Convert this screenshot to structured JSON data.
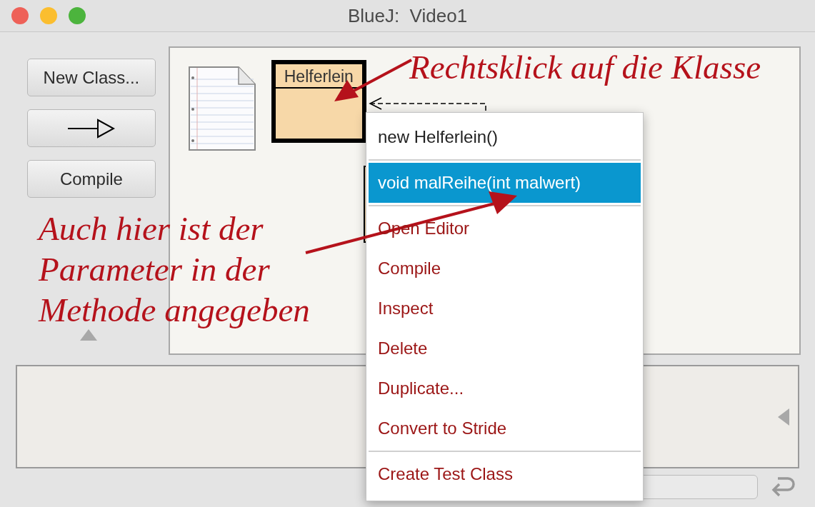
{
  "window": {
    "title": "BlueJ:  Video1"
  },
  "toolbar_buttons": [
    {
      "kind": "text",
      "label": "New Class..."
    },
    {
      "kind": "arrow"
    },
    {
      "kind": "text",
      "label": "Compile"
    }
  ],
  "diagram": {
    "classes": [
      {
        "name": "Helferlein"
      }
    ]
  },
  "context_menu": {
    "sections": [
      [
        {
          "label": "new Helferlein()",
          "kind": "constructor",
          "selected": false
        }
      ],
      [
        {
          "label": "void malReihe(int malwert)",
          "kind": "method",
          "selected": true
        }
      ],
      [
        {
          "label": "Open Editor",
          "kind": "command",
          "selected": false
        },
        {
          "label": "Compile",
          "kind": "command",
          "selected": false
        },
        {
          "label": "Inspect",
          "kind": "command",
          "selected": false
        },
        {
          "label": "Delete",
          "kind": "command",
          "selected": false
        },
        {
          "label": "Duplicate...",
          "kind": "command",
          "selected": false
        },
        {
          "label": "Convert to Stride",
          "kind": "command",
          "selected": false
        }
      ],
      [
        {
          "label": "Create Test Class",
          "kind": "command",
          "selected": false
        }
      ]
    ]
  },
  "annotations": [
    {
      "lines": [
        "Rechtsklick auf die Klasse"
      ]
    },
    {
      "lines": [
        "Auch hier ist der",
        "Parameter in der",
        "Methode angegeben"
      ]
    }
  ]
}
